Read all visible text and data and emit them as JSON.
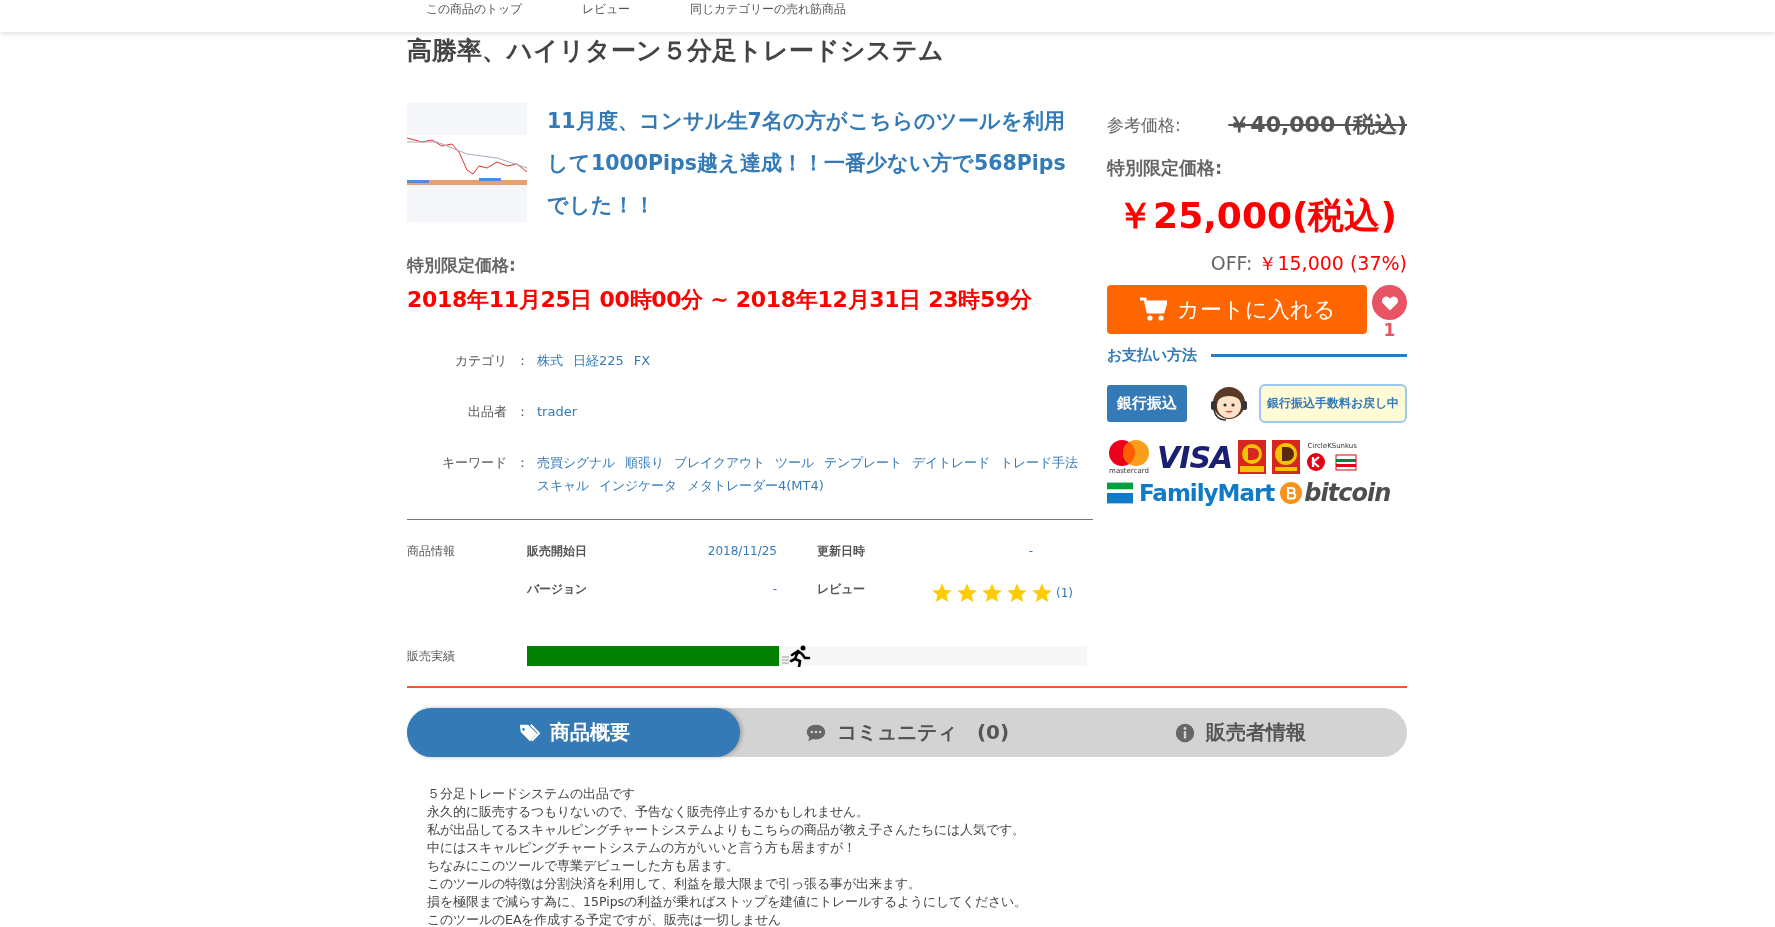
{
  "nav": [
    {
      "label": "この商品のトップ"
    },
    {
      "label": "レビュー"
    },
    {
      "label": "同じカテゴリーの売れ筋商品"
    }
  ],
  "title": "高勝率、ハイリターン５分足トレードシステム",
  "headline": "11月度、コンサル生7名の方がこちらのツールを利用して1000Pips越え達成！！一番少ない方で568Pipsでした！！",
  "period": {
    "label": "特別限定価格:",
    "value": "2018年11月25日 00時00分 ~ 2018年12月31日 23時59分"
  },
  "attributes": [
    {
      "label": "カテゴリ",
      "separator": "：",
      "values": [
        "株式",
        "日経225",
        "FX"
      ]
    },
    {
      "label": "出品者",
      "separator": "：",
      "values": [
        "trader"
      ]
    },
    {
      "label": "キーワード",
      "separator": "：",
      "values": [
        "売買シグナル",
        "順張り",
        "ブレイクアウト",
        "ツール",
        "テンプレート",
        "デイトレード",
        "トレード手法",
        "スキャル",
        "インジケータ",
        "メタトレーダー4(MT4)"
      ]
    }
  ],
  "product_info": {
    "label": "商品情報",
    "release_label": "販売開始日",
    "release": "2018/11/25",
    "updated_label": "更新日時",
    "updated": "-",
    "version_label": "バージョン",
    "version": "-",
    "review_label": "レビュー",
    "stars": 5,
    "review_count": "(1)"
  },
  "sales": {
    "label": "販売実績",
    "level": 0.45
  },
  "price": {
    "reference_label": "参考価格:",
    "reference": "￥40,000 (税込)",
    "special_label": "特別限定価格:",
    "special": "￥25,000(税込)",
    "off_label": "OFF:",
    "off": "￥15,000 (37%)"
  },
  "cart_button": "カートに入れる",
  "favorite": {
    "count": "1"
  },
  "payment": {
    "heading": "お支払い方法",
    "bank_button": "銀行振込",
    "notice": "銀行振込手数料お戻し中",
    "logos": [
      {
        "kind": "mastercard",
        "label": "mastercard"
      },
      {
        "kind": "visa",
        "label": "VISA"
      },
      {
        "kind": "daily"
      },
      {
        "kind": "yamazaki"
      },
      {
        "kind": "circlek",
        "label": "CircleKSunkus"
      },
      {
        "kind": "familymart",
        "label": "FamilyMart"
      },
      {
        "kind": "bitcoin",
        "label": "bitcoin"
      }
    ]
  },
  "tabs": [
    {
      "label": "商品概要",
      "kind": "tags",
      "selected": true
    },
    {
      "label": "コミュニティ　(0)",
      "kind": "comment",
      "selected": false
    },
    {
      "label": "販売者情報",
      "kind": "info",
      "selected": false
    }
  ],
  "description": [
    "５分足トレードシステムの出品です",
    "永久的に販売するつもりないので、予告なく販売停止するかもしれません。",
    "私が出品してるスキャルピングチャートシステムよりもこちらの商品が教え子さんたちには人気です。",
    "中にはスキャルピングチャートシステムの方がいいと言う方も居ますが！",
    "ちなみにこのツールで専業デビューした方も居ます。",
    "このツールの特徴は分割決済を利用して、利益を最大限まで引っ張る事が出来ます。",
    "損を極限まで減らす為に、15Pipsの利益が乗ればストップを建値にトレールするようにしてください。",
    "このツールのEAを作成する予定ですが、販売は一切しません"
  ]
}
